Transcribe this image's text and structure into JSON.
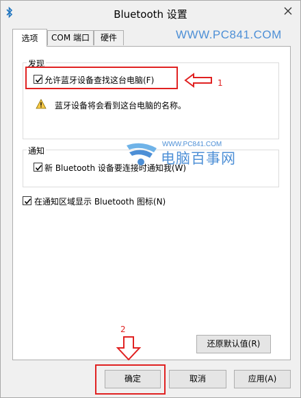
{
  "window": {
    "title": "Bluetooth 设置",
    "icon": "bluetooth-icon",
    "close_icon": "close-icon"
  },
  "tabs": [
    {
      "label": "选项",
      "active": true
    },
    {
      "label": "COM 端口",
      "active": false
    },
    {
      "label": "硬件",
      "active": false
    }
  ],
  "watermark": {
    "url_top": "WWW.PC841.COM",
    "url_small": "WWW.PC841.COM",
    "site_name": "电脑百事网"
  },
  "discovery": {
    "group_label": "发现",
    "allow_discovery_label": "允许蓝牙设备查找这台电脑(F)",
    "allow_discovery_checked": true,
    "warning_text": "蓝牙设备将会看到这台电脑的名称。"
  },
  "notifications": {
    "group_label": "通知",
    "notify_label": "新 Bluetooth 设备要连接时通知我(W)",
    "notify_checked": true
  },
  "tray": {
    "show_icon_label": "在通知区域显示 Bluetooth 图标(N)",
    "show_icon_checked": true
  },
  "buttons": {
    "restore_defaults": "还原默认值(R)",
    "ok": "确定",
    "cancel": "取消",
    "apply": "应用(A)"
  },
  "annotations": {
    "marker_1": "1",
    "marker_2": "2",
    "color": "#e02020"
  }
}
